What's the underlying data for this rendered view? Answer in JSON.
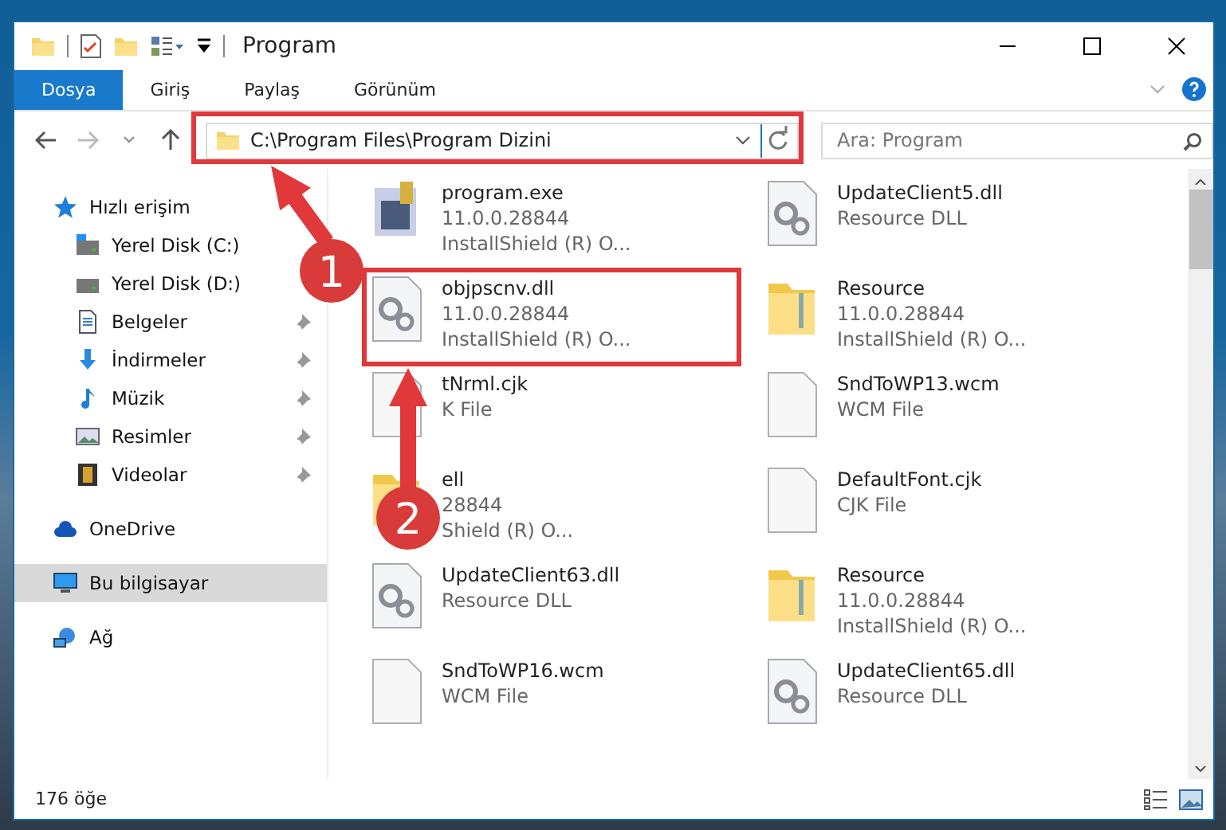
{
  "window": {
    "title": "Program"
  },
  "ribbon_tabs": [
    {
      "label": "Dosya",
      "selected": true
    },
    {
      "label": "Giriş",
      "selected": false
    },
    {
      "label": "Paylaş",
      "selected": false
    },
    {
      "label": "Görünüm",
      "selected": false
    }
  ],
  "address": {
    "path": "C:\\Program Files\\Program Dizini"
  },
  "search": {
    "placeholder": "Ara: Program"
  },
  "sidebar": {
    "items": [
      {
        "label": "Hızlı erişim",
        "selected": false,
        "children": [
          {
            "label": "Yerel Disk (C:)",
            "pinned": false,
            "selected": false
          },
          {
            "label": "Yerel Disk (D:)",
            "pinned": false,
            "selected": false
          },
          {
            "label": "Belgeler",
            "pinned": true,
            "selected": false
          },
          {
            "label": "İndirmeler",
            "pinned": true,
            "selected": false
          },
          {
            "label": "Müzik",
            "pinned": true,
            "selected": false
          },
          {
            "label": "Resimler",
            "pinned": true,
            "selected": false
          },
          {
            "label": "Videolar",
            "pinned": true,
            "selected": false
          }
        ]
      },
      {
        "label": "OneDrive",
        "selected": false
      },
      {
        "label": "Bu bilgisayar",
        "selected": true
      },
      {
        "label": "Ağ",
        "selected": false
      }
    ]
  },
  "files": [
    {
      "kind": "exe",
      "name": "program.exe",
      "lines": [
        "11.0.0.28844",
        "InstallShield (R) O..."
      ]
    },
    {
      "kind": "dll",
      "name": "UpdateClient5.dll",
      "lines": [
        "Resource DLL"
      ]
    },
    {
      "kind": "dll",
      "name": "objpscnv.dll",
      "lines": [
        "11.0.0.28844",
        "InstallShield (R) O..."
      ]
    },
    {
      "kind": "folder",
      "name": "Resource",
      "lines": [
        "11.0.0.28844",
        "InstallShield (R) O..."
      ]
    },
    {
      "kind": "file",
      "name": "tNrml.cjk",
      "lines": [
        "K File"
      ]
    },
    {
      "kind": "file",
      "name": "SndToWP13.wcm",
      "lines": [
        "WCM File"
      ]
    },
    {
      "kind": "folder",
      "name": "ell",
      "lines": [
        "28844",
        "Shield (R) O..."
      ]
    },
    {
      "kind": "file",
      "name": "DefaultFont.cjk",
      "lines": [
        "CJK File"
      ]
    },
    {
      "kind": "dll",
      "name": "UpdateClient63.dll",
      "lines": [
        "Resource DLL"
      ]
    },
    {
      "kind": "folder",
      "name": "Resource",
      "lines": [
        "11.0.0.28844",
        "InstallShield (R) O..."
      ]
    },
    {
      "kind": "file",
      "name": "SndToWP16.wcm",
      "lines": [
        "WCM File"
      ]
    },
    {
      "kind": "dll",
      "name": "UpdateClient65.dll",
      "lines": [
        "Resource DLL"
      ]
    }
  ],
  "status_bar": {
    "count": "176 öğe"
  },
  "annotations": {
    "steps": [
      "1",
      "2"
    ]
  }
}
